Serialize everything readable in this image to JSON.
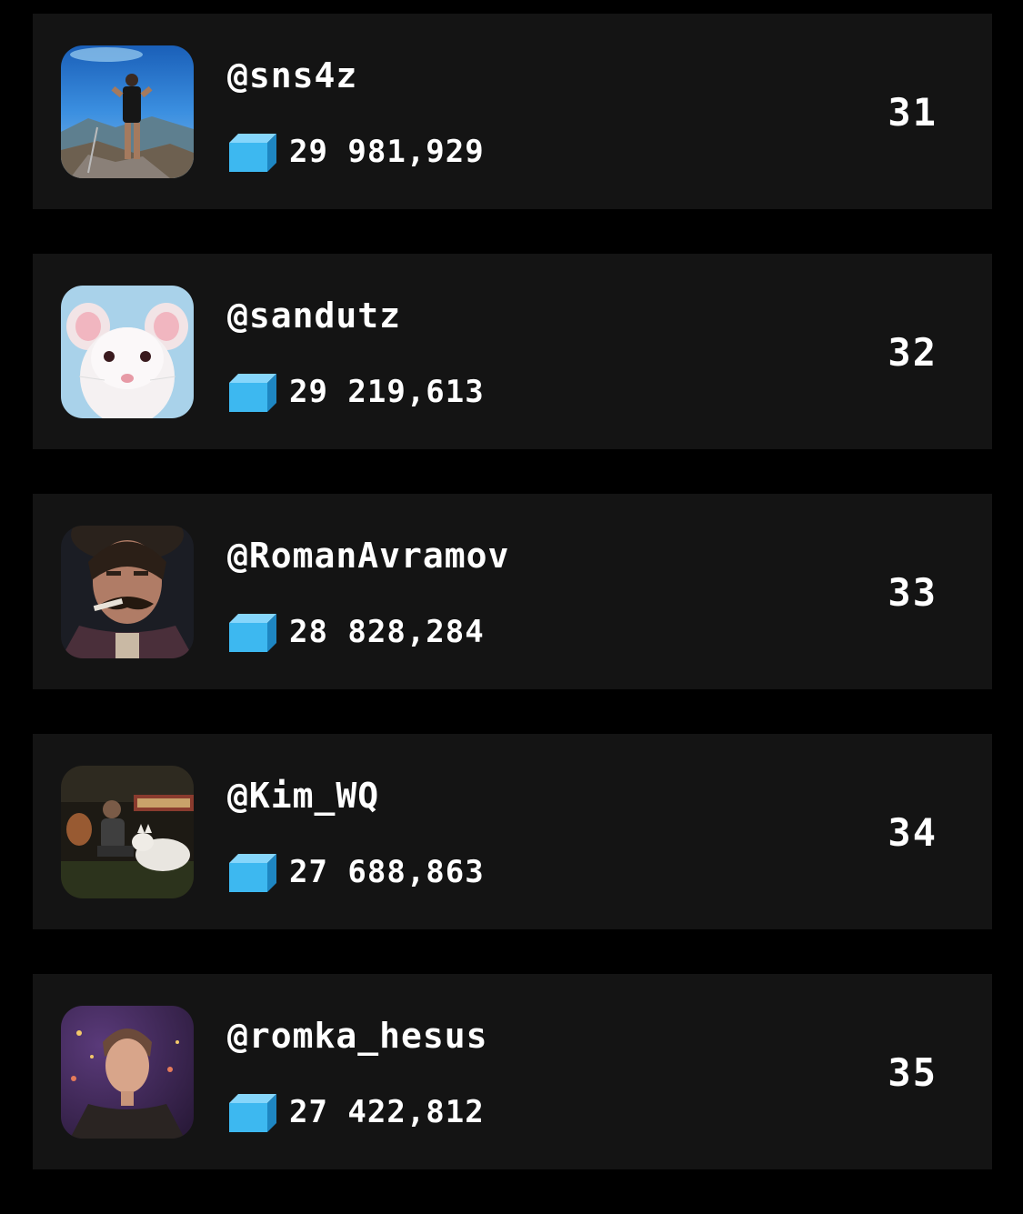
{
  "leaderboard": {
    "entries": [
      {
        "username": "@sns4z",
        "score": "29 981,929",
        "rank": "31",
        "avatar": "man-on-mountain-photo"
      },
      {
        "username": "@sandutz",
        "score": "29 219,613",
        "rank": "32",
        "avatar": "white-rat-photo"
      },
      {
        "username": "@RomanAvramov",
        "score": "28 828,284",
        "rank": "33",
        "avatar": "mustached-man-portrait"
      },
      {
        "username": "@Kim_WQ",
        "score": "27 688,863",
        "rank": "34",
        "avatar": "person-with-dog-night-photo"
      },
      {
        "username": "@romka_hesus",
        "score": "27 422,812",
        "rank": "35",
        "avatar": "young-man-night-portrait"
      }
    ],
    "score_icon": "cube-icon",
    "colors": {
      "background": "#000000",
      "card": "#141414",
      "text": "#ffffff",
      "cube": "#3db8f0"
    }
  }
}
